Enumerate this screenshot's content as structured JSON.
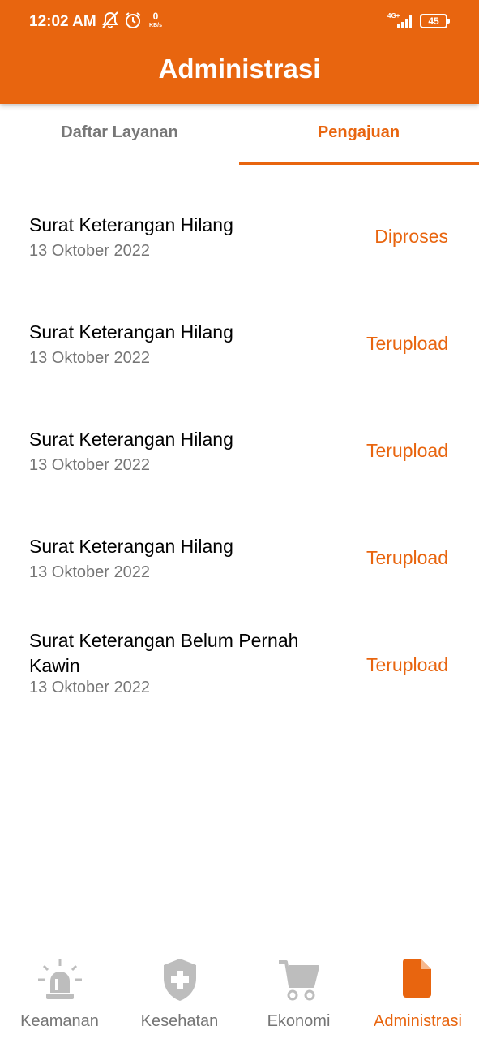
{
  "status_bar": {
    "time": "12:02 AM",
    "speed_value": "0",
    "speed_unit": "KB/s",
    "network": "4G+",
    "battery": "45"
  },
  "header": {
    "title": "Administrasi"
  },
  "tabs": [
    {
      "label": "Daftar Layanan",
      "selected": false
    },
    {
      "label": "Pengajuan",
      "selected": true
    }
  ],
  "submissions": [
    {
      "title": "Surat Keterangan Hilang",
      "date": "13 Oktober 2022",
      "status": "Diproses"
    },
    {
      "title": "Surat Keterangan Hilang",
      "date": "13 Oktober 2022",
      "status": "Terupload"
    },
    {
      "title": "Surat Keterangan Hilang",
      "date": "13 Oktober 2022",
      "status": "Terupload"
    },
    {
      "title": "Surat Keterangan Hilang",
      "date": "13 Oktober 2022",
      "status": "Terupload"
    },
    {
      "title": "Surat Keterangan Belum Pernah Kawin",
      "date": "13 Oktober 2022",
      "status": "Terupload"
    }
  ],
  "bottom_nav": [
    {
      "label": "Keamanan",
      "icon": "siren-icon",
      "active": false
    },
    {
      "label": "Kesehatan",
      "icon": "medical-shield-icon",
      "active": false
    },
    {
      "label": "Ekonomi",
      "icon": "cart-icon",
      "active": false
    },
    {
      "label": "Administrasi",
      "icon": "document-icon",
      "active": true
    }
  ],
  "colors": {
    "accent": "#E8650F",
    "muted": "#757575",
    "icon_inactive": "#BDBDBD"
  }
}
